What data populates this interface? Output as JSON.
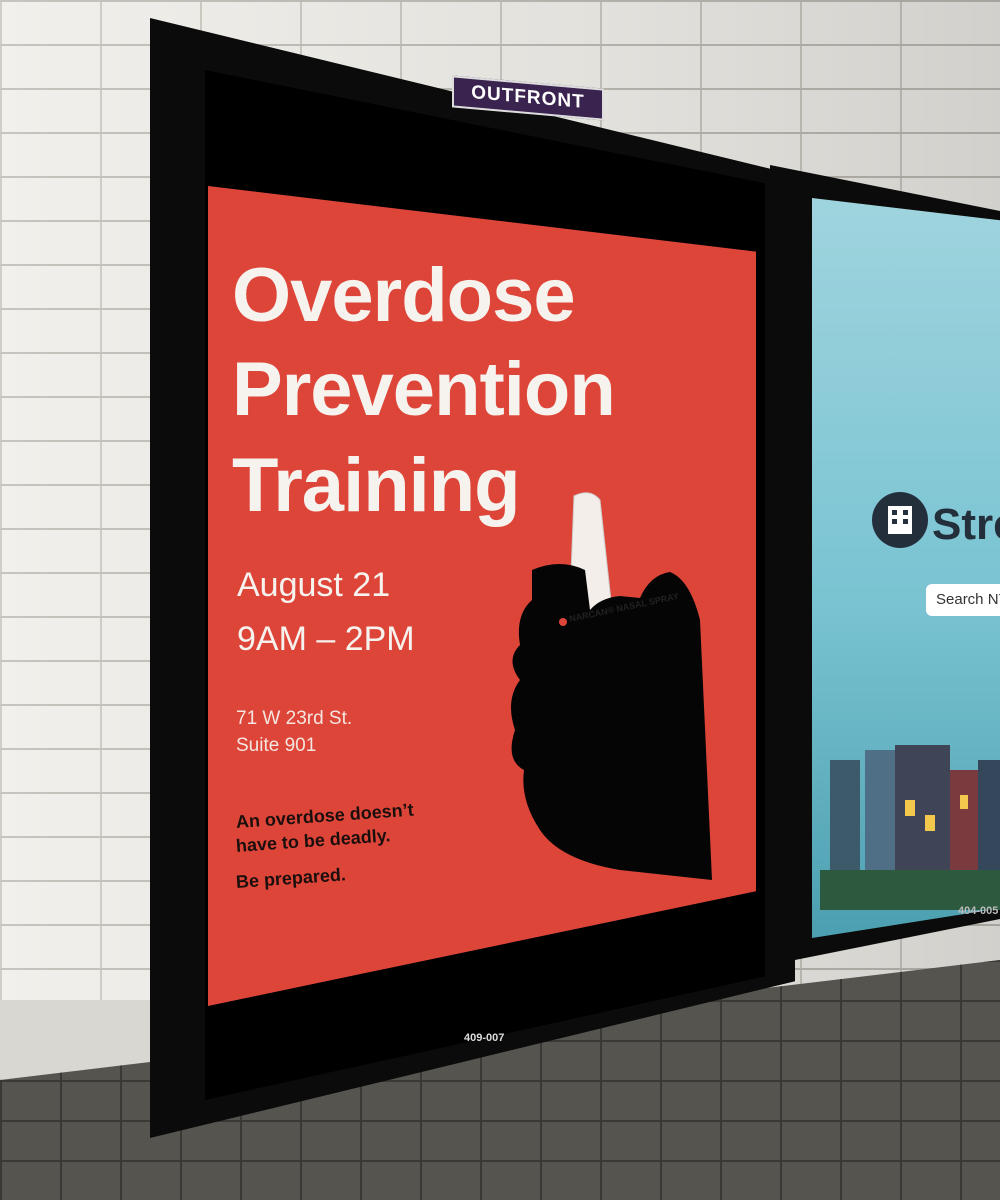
{
  "sign": {
    "brand": "OUTFRONT"
  },
  "poster": {
    "title_lines": [
      "Overdose",
      "Prevention",
      "Training"
    ],
    "date": "August 21",
    "time": "9AM – 2PM",
    "address_line1": "71 W 23rd St.",
    "address_line2": "Suite 901",
    "tagline_line1": "An overdose doesn’t",
    "tagline_line2": "have to be deadly.",
    "tagline_cta": "Be prepared.",
    "product_label": "NARCAN® NASAL SPRAY",
    "panel_code": "409-007",
    "accent_color": "#de4539"
  },
  "right_ad": {
    "partial_title": "Stre",
    "search_label": "Search NYC",
    "panel_code": "404-005",
    "logo_icon": "building-icon"
  }
}
